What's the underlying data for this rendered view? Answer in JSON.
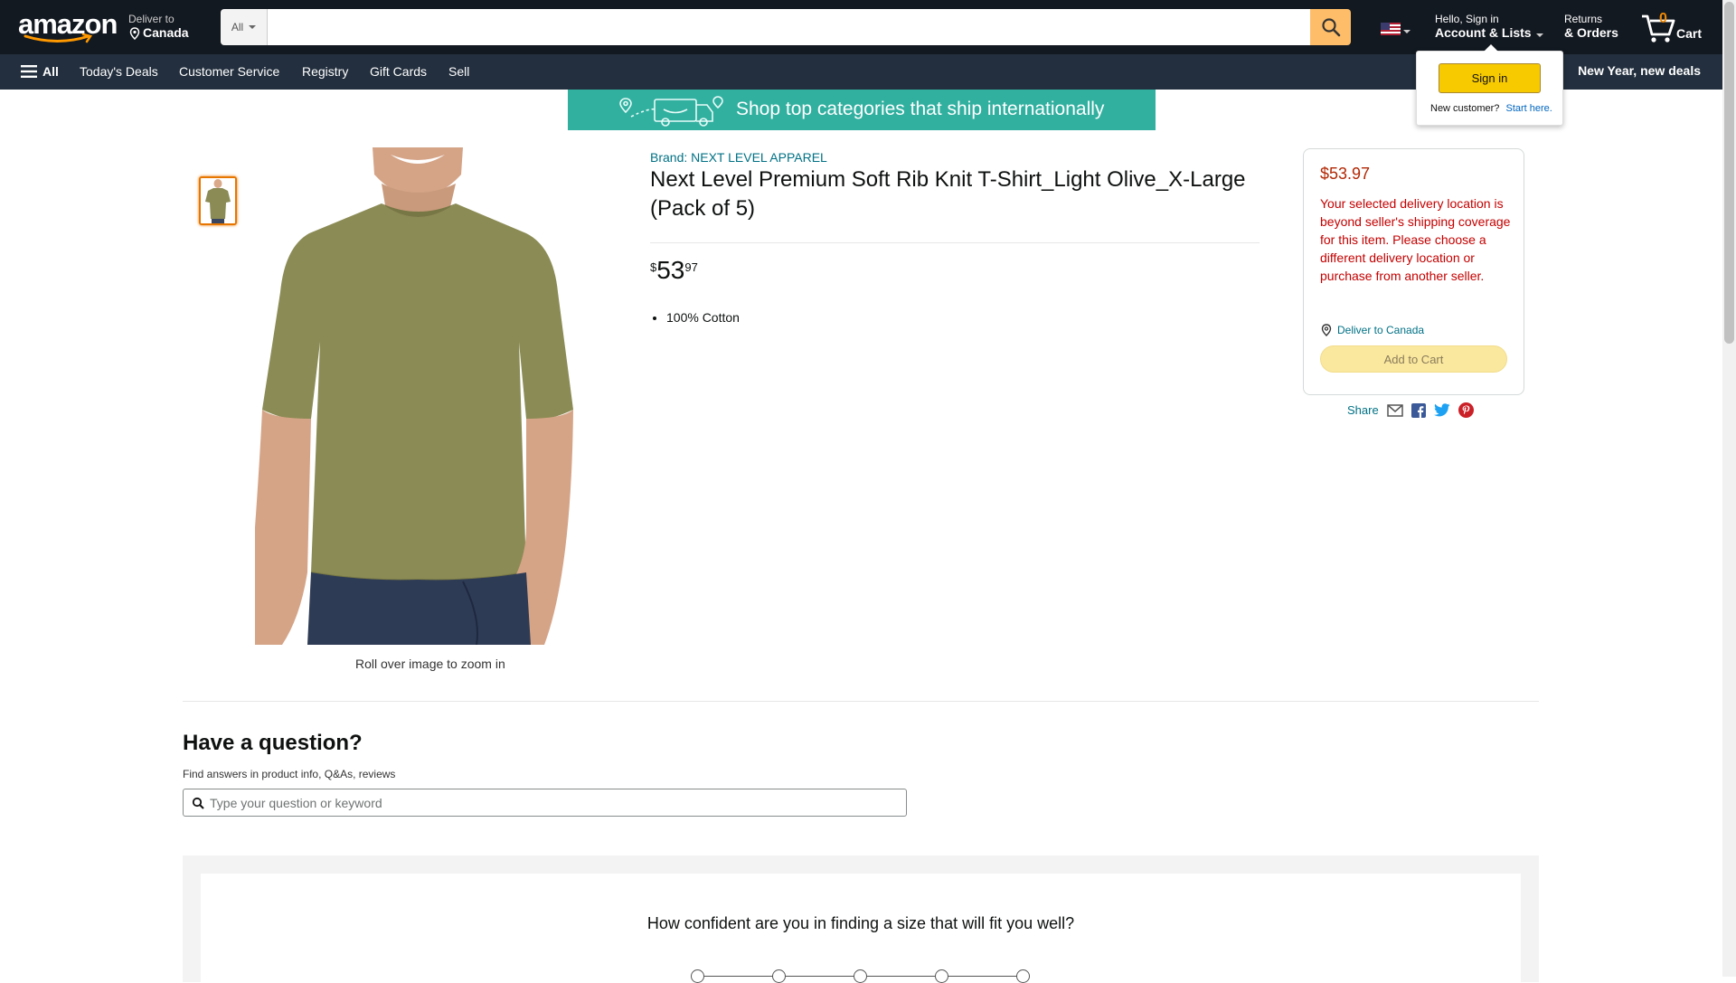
{
  "header": {
    "logo_text": "amazon",
    "deliver_line1": "Deliver to",
    "deliver_line2": "Canada",
    "search_category": "All",
    "search_placeholder": "",
    "account_line1": "Hello, Sign in",
    "account_line2": "Account & Lists",
    "returns_line1": "Returns",
    "returns_line2": "& Orders",
    "cart_count": "0",
    "cart_label": "Cart"
  },
  "nav": {
    "all_label": "All",
    "items": [
      "Today's Deals",
      "Customer Service",
      "Registry",
      "Gift Cards",
      "Sell"
    ],
    "promo": "New Year, new deals"
  },
  "signin_popover": {
    "button": "Sign in",
    "new_customer": "New customer?",
    "start_here": "Start here."
  },
  "banner": {
    "text": "Shop top categories that ship internationally"
  },
  "product": {
    "brand": "Brand: NEXT LEVEL APPAREL",
    "title": "Next Level Premium Soft Rib Knit T-Shirt_Light Olive_X-Large (Pack of 5)",
    "price_symbol": "$",
    "price_whole": "53",
    "price_fraction": "97",
    "bullets": [
      "100% Cotton"
    ],
    "zoom_note": "Roll over image to zoom in",
    "shirt_color": "#8b8b55"
  },
  "buybox": {
    "price": "$53.97",
    "message": "Your selected delivery location is beyond seller's shipping coverage for this item. Please choose a different delivery location or purchase from another seller.",
    "deliver_link": "Deliver to Canada",
    "add_to_cart": "Add to Cart",
    "share_label": "Share"
  },
  "qa": {
    "title": "Have a question?",
    "subtitle": "Find answers in product info, Q&As, reviews",
    "placeholder": "Type your question or keyword"
  },
  "survey": {
    "question": "How confident are you in finding a size that will fit you well?"
  },
  "colors": {
    "nav_dark": "#131921",
    "nav_secondary": "#232f3e",
    "search_button": "#febd69",
    "link": "#007185",
    "error": "#c40000",
    "price_red": "#b12704"
  }
}
